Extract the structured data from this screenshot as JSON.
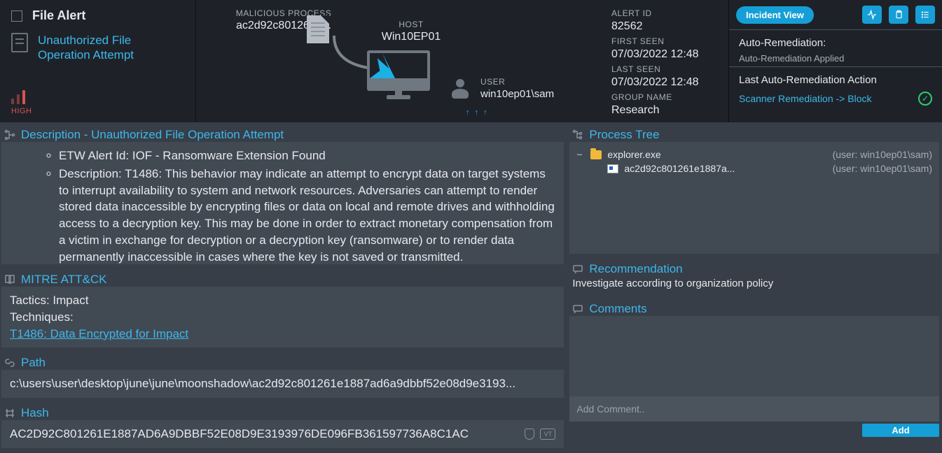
{
  "header": {
    "title": "File Alert",
    "subtitle": "Unauthorized File Operation Attempt",
    "severity": "HIGH",
    "malicious_process_label": "MALICIOUS PROCESS",
    "malicious_process_value": "ac2d92c801261e...",
    "host_label": "HOST",
    "host_value": "Win10EP01",
    "user_label": "USER",
    "user_value": "win10ep01\\sam",
    "net_arrows": "↑ ↑ ↑"
  },
  "meta": {
    "alert_id_label": "ALERT ID",
    "alert_id_value": "82562",
    "first_seen_label": "FIRST SEEN",
    "first_seen_value": "07/03/2022 12:48",
    "last_seen_label": "LAST SEEN",
    "last_seen_value": "07/03/2022 12:48",
    "group_label": "GROUP NAME",
    "group_value": "Research"
  },
  "actions": {
    "incident_view": "Incident View",
    "auto_rem_title": "Auto-Remediation:",
    "auto_rem_status": "Auto-Remediation Applied",
    "last_action_title": "Last Auto-Remediation Action",
    "last_action_link": "Scanner Remediation -> Block"
  },
  "description": {
    "heading": "Description - Unauthorized File Operation Attempt",
    "bullets": [
      "ETW Alert Id: IOF - Ransomware Extension Found",
      "Description: T1486: This behavior may indicate an attempt to encrypt data on target systems to interrupt availability to system and network resources. Adversaries can attempt to render stored data inaccessible by encrypting files or data on local and remote drives and withholding access to a decryption key. This may be done in order to extract monetary compensation from a victim in exchange for decryption or a decryption key (ransomware) or to render data permanently inaccessible in cases where the key is not saved or transmitted."
    ]
  },
  "mitre": {
    "heading": "MITRE ATT&CK",
    "tactics_label": "Tactics:",
    "tactics_value": "Impact",
    "techniques_label": "Techniques:",
    "technique_link": "T1486: Data Encrypted for Impact"
  },
  "path": {
    "heading": "Path",
    "value": "c:\\users\\user\\desktop\\june\\june\\moonshadow\\ac2d92c801261e1887ad6a9dbbf52e08d9e3193..."
  },
  "hash": {
    "heading": "Hash",
    "value": "AC2D92C801261E1887AD6A9DBBF52E08D9E3193976DE096FB361597736A8C1AC",
    "vt": "VT"
  },
  "tree": {
    "heading": "Process Tree",
    "nodes": [
      {
        "name": "explorer.exe",
        "user": "(user: win10ep01\\sam)",
        "icon": "folder"
      },
      {
        "name": "ac2d92c801261e1887a...",
        "user": "(user: win10ep01\\sam)",
        "icon": "exe"
      }
    ]
  },
  "recommendation": {
    "heading": "Recommendation",
    "text": "Investigate according to organization policy"
  },
  "comments": {
    "heading": "Comments",
    "placeholder": "Add Comment..",
    "add": "Add"
  }
}
